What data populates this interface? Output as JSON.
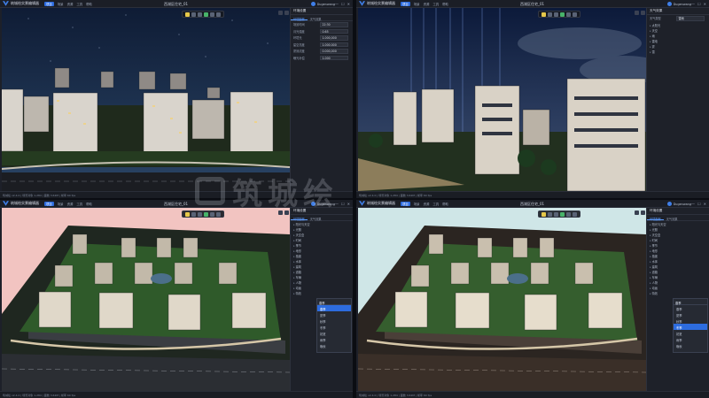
{
  "app": {
    "title": "筑城绘实景编辑器",
    "project_title": "西湖区住宅_01",
    "user_name": "Dugenwang",
    "menu": [
      "项目",
      "场景",
      "资源",
      "工具",
      "帮助"
    ],
    "window_controls": [
      "—",
      "☐",
      "✕"
    ]
  },
  "status_text": "筑城绘 v2.4.0  |  场景对象 1,284  |  面数 3.62M  |  帧率 60 fps",
  "panels": {
    "settings_title": "环境设置",
    "tabs": [
      "环境配置",
      "天气效果"
    ],
    "properties": [
      {
        "label": "场景时间",
        "value": "22:30"
      },
      {
        "label": "月光强度",
        "value": "0.65"
      },
      {
        "label": "环境光",
        "value": "1.000,000"
      },
      {
        "label": "星空亮度",
        "value": "1.000,000"
      },
      {
        "label": "雾效浓度",
        "value": "0.000,000"
      },
      {
        "label": "曝光补偿",
        "value": "1.000"
      }
    ],
    "weather": {
      "title": "天气效果",
      "effect_label": "天气类型",
      "effect_value": "雷雨",
      "tree": [
        "太阳光",
        "天空",
        "雨",
        "雷电",
        "雾",
        "雪"
      ]
    },
    "tree_items": [
      "阳光与天空",
      "光照",
      "天空盒",
      "时间",
      "季节",
      "地形",
      "植被",
      "水体",
      "建筑",
      "道路",
      "车辆",
      "人物",
      "动画",
      "特效"
    ],
    "dropdown": {
      "selected": "春季",
      "options": [
        "春季",
        "夏季",
        "秋季",
        "冬季",
        "初夏",
        "雨季",
        "晚秋"
      ]
    }
  },
  "viewports": {
    "top_left": {
      "scene": "night",
      "sky_color": "#1a2a45"
    },
    "top_right": {
      "scene": "storm",
      "sky_color": "#1c2d4c"
    },
    "bottom_left": {
      "scene": "aerial-pink",
      "ground_color": "#f2c4c1"
    },
    "bottom_right": {
      "scene": "aerial-cyan",
      "ground_color": "#cfe6e7"
    }
  },
  "colors": {
    "accent": "#2d6cdf",
    "panel_bg": "#1e2129",
    "toolbar_bg": "#1b1e26"
  },
  "watermark": "筑城绘"
}
